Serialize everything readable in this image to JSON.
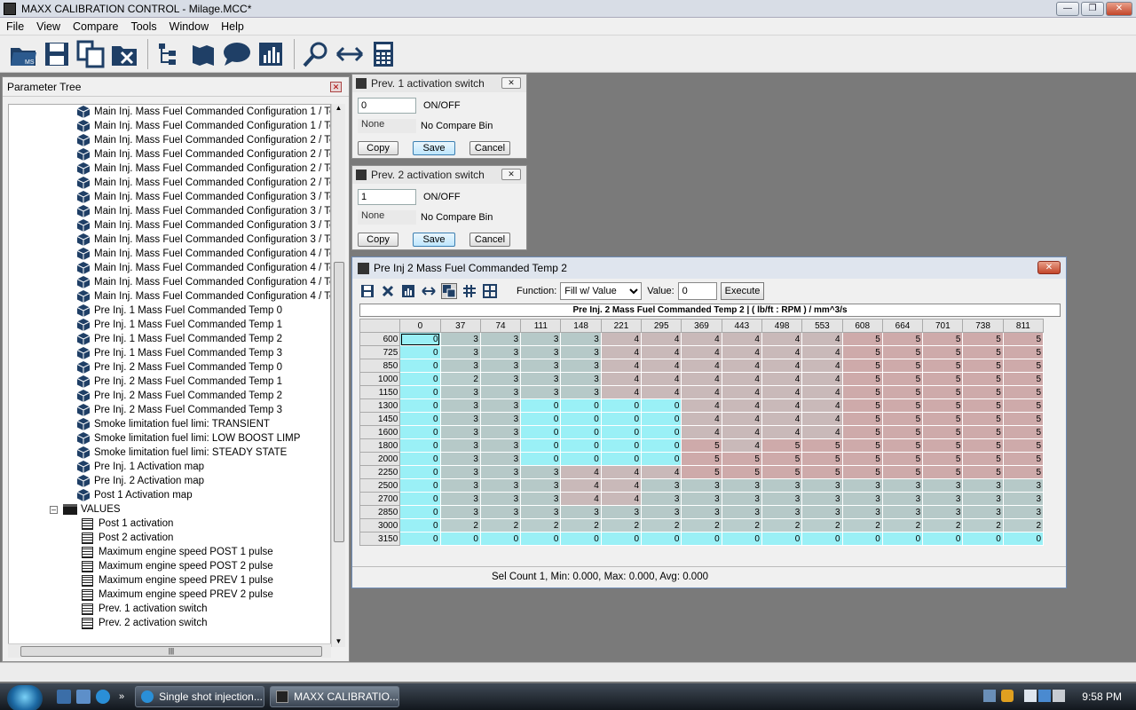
{
  "window": {
    "title": "MAXX CALIBRATION CONTROL - Milage.MCC*"
  },
  "menu": [
    "File",
    "View",
    "Compare",
    "Tools",
    "Window",
    "Help"
  ],
  "toolbar": [
    "open-icon",
    "save-icon",
    "copy-icon",
    "close-file-icon",
    "tree-icon",
    "map-icon",
    "speech-icon",
    "chart-icon",
    "search-icon",
    "compare-arrows-icon",
    "calculator-icon"
  ],
  "tree": {
    "title": "Parameter Tree",
    "items": [
      "Main Inj. Mass Fuel Commanded Configuration 1 / Temp",
      "Main Inj. Mass Fuel Commanded Configuration 1 / Temp",
      "Main Inj. Mass Fuel Commanded Configuration 2 / Temp",
      "Main Inj. Mass Fuel Commanded Configuration 2 / Temp",
      "Main Inj. Mass Fuel Commanded Configuration 2 / Temp",
      "Main Inj. Mass Fuel Commanded Configuration 2 / Temp",
      "Main Inj. Mass Fuel Commanded Configuration 3 / Temp",
      "Main Inj. Mass Fuel Commanded Configuration 3 / Temp",
      "Main Inj. Mass Fuel Commanded Configuration 3 / Temp",
      "Main Inj. Mass Fuel Commanded Configuration 3 / Temp",
      "Main Inj. Mass Fuel Commanded Configuration 4 / Temp",
      "Main Inj. Mass Fuel Commanded Configuration 4 / Temp",
      "Main Inj. Mass Fuel Commanded Configuration 4 / Temp",
      "Main Inj. Mass Fuel Commanded Configuration 4 / Temp",
      "Pre Inj. 1 Mass Fuel Commanded Temp 0",
      "Pre Inj. 1 Mass Fuel Commanded Temp 1",
      "Pre Inj. 1 Mass Fuel Commanded Temp 2",
      "Pre Inj. 1 Mass Fuel Commanded Temp 3",
      "Pre Inj. 2 Mass Fuel Commanded Temp 0",
      "Pre Inj. 2 Mass Fuel Commanded Temp 1",
      "Pre Inj. 2 Mass Fuel Commanded Temp 2",
      "Pre Inj. 2 Mass Fuel Commanded Temp 3",
      "Smoke limitation fuel limi: TRANSIENT",
      "Smoke limitation fuel limi: LOW BOOST LIMP",
      "Smoke limitation fuel limi: STEADY STATE",
      "Pre Inj. 1 Activation map",
      "Pre Inj. 2 Activation map",
      "Post 1 Activation map"
    ],
    "folder": "VALUES",
    "values": [
      "Post 1 activation",
      "Post 2 activation",
      "Maximum engine speed POST 1 pulse",
      "Maximum engine speed POST 2 pulse",
      "Maximum engine speed PREV 1 pulse",
      "Maximum engine speed PREV 2 pulse",
      "Prev. 1 activation switch",
      "Prev. 2 activation switch"
    ]
  },
  "sw1": {
    "title": "Prev. 1 activation switch",
    "value": "0",
    "unit": "ON/OFF",
    "compare": "None",
    "compare_label": "No Compare Bin",
    "copy": "Copy",
    "save": "Save",
    "cancel": "Cancel"
  },
  "sw2": {
    "title": "Prev. 2 activation switch",
    "value": "1",
    "unit": "ON/OFF",
    "compare": "None",
    "compare_label": "No Compare Bin",
    "copy": "Copy",
    "save": "Save",
    "cancel": "Cancel"
  },
  "table": {
    "title": "Pre Inj 2 Mass Fuel Commanded Temp 2",
    "function_label": "Function:",
    "function_value": "Fill w/ Value",
    "value_label": "Value:",
    "value": "0",
    "execute": "Execute",
    "header": "Pre Inj. 2 Mass Fuel Commanded Temp 2 |  ( lb/ft : RPM ) / mm^3/s",
    "cols": [
      "0",
      "37",
      "74",
      "111",
      "148",
      "221",
      "295",
      "369",
      "443",
      "498",
      "553",
      "608",
      "664",
      "701",
      "738",
      "811"
    ],
    "rows": [
      "600",
      "725",
      "850",
      "1000",
      "1150",
      "1300",
      "1450",
      "1600",
      "1800",
      "2000",
      "2250",
      "2500",
      "2700",
      "2850",
      "3000",
      "3150"
    ],
    "values": [
      [
        0,
        3,
        3,
        3,
        3,
        4,
        4,
        4,
        4,
        4,
        4,
        5,
        5,
        5,
        5,
        5
      ],
      [
        0,
        3,
        3,
        3,
        3,
        4,
        4,
        4,
        4,
        4,
        4,
        5,
        5,
        5,
        5,
        5
      ],
      [
        0,
        3,
        3,
        3,
        3,
        4,
        4,
        4,
        4,
        4,
        4,
        5,
        5,
        5,
        5,
        5
      ],
      [
        0,
        2,
        3,
        3,
        3,
        4,
        4,
        4,
        4,
        4,
        4,
        5,
        5,
        5,
        5,
        5
      ],
      [
        0,
        3,
        3,
        3,
        3,
        4,
        4,
        4,
        4,
        4,
        4,
        5,
        5,
        5,
        5,
        5
      ],
      [
        0,
        3,
        3,
        0,
        0,
        0,
        0,
        4,
        4,
        4,
        4,
        5,
        5,
        5,
        5,
        5
      ],
      [
        0,
        3,
        3,
        0,
        0,
        0,
        0,
        4,
        4,
        4,
        4,
        5,
        5,
        5,
        5,
        5
      ],
      [
        0,
        3,
        3,
        0,
        0,
        0,
        0,
        4,
        4,
        4,
        4,
        5,
        5,
        5,
        5,
        5
      ],
      [
        0,
        3,
        3,
        0,
        0,
        0,
        0,
        5,
        4,
        5,
        5,
        5,
        5,
        5,
        5,
        5
      ],
      [
        0,
        3,
        3,
        0,
        0,
        0,
        0,
        5,
        5,
        5,
        5,
        5,
        5,
        5,
        5,
        5
      ],
      [
        0,
        3,
        3,
        3,
        4,
        4,
        4,
        5,
        5,
        5,
        5,
        5,
        5,
        5,
        5,
        5
      ],
      [
        0,
        3,
        3,
        3,
        4,
        4,
        3,
        3,
        3,
        3,
        3,
        3,
        3,
        3,
        3,
        3
      ],
      [
        0,
        3,
        3,
        3,
        4,
        4,
        3,
        3,
        3,
        3,
        3,
        3,
        3,
        3,
        3,
        3
      ],
      [
        0,
        3,
        3,
        3,
        3,
        3,
        3,
        3,
        3,
        3,
        3,
        3,
        3,
        3,
        3,
        3
      ],
      [
        0,
        2,
        2,
        2,
        2,
        2,
        2,
        2,
        2,
        2,
        2,
        2,
        2,
        2,
        2,
        2
      ],
      [
        0,
        0,
        0,
        0,
        0,
        0,
        0,
        0,
        0,
        0,
        0,
        0,
        0,
        0,
        0,
        0
      ]
    ],
    "colors": {
      "0": "#9af0f6",
      "2": "#b9cdcc",
      "3": "#b6c9c8",
      "4": "#c9b9b9",
      "5": "#ceaaaa"
    },
    "status": "Sel Count 1, Min: 0.000, Max: 0.000, Avg: 0.000"
  },
  "taskbar": {
    "tasks": [
      "Single shot injection...",
      "MAXX CALIBRATIO..."
    ],
    "clock": "9:58 PM"
  }
}
